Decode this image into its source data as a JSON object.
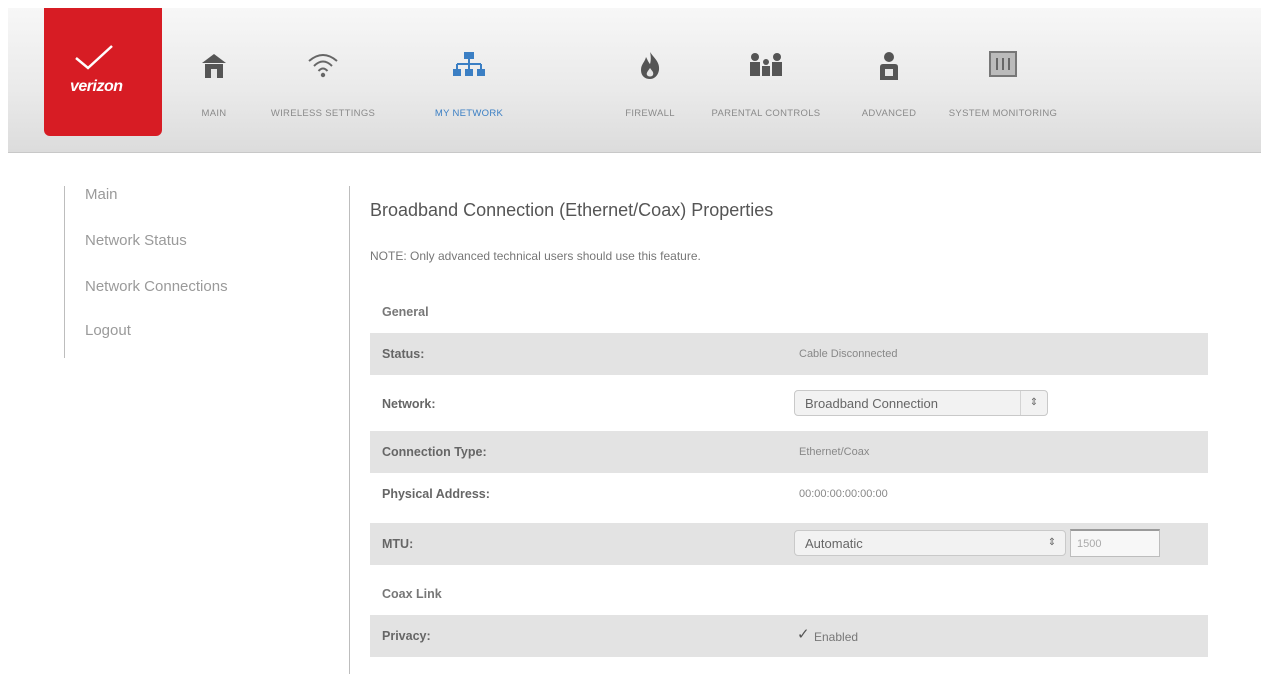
{
  "header": {
    "logo_text": "verizon",
    "nav": [
      {
        "label": "MAIN",
        "icon": "home-icon",
        "active": false
      },
      {
        "label": "WIRELESS SETTINGS",
        "icon": "wifi-icon",
        "active": false
      },
      {
        "label": "MY NETWORK",
        "icon": "network-icon",
        "active": true
      },
      {
        "label": "FIREWALL",
        "icon": "fire-icon",
        "active": false
      },
      {
        "label": "PARENTAL CONTROLS",
        "icon": "family-icon",
        "active": false
      },
      {
        "label": "ADVANCED",
        "icon": "admin-icon",
        "active": false
      },
      {
        "label": "SYSTEM MONITORING",
        "icon": "monitor-icon",
        "active": false
      }
    ]
  },
  "sidebar": {
    "items": [
      {
        "label": "Main"
      },
      {
        "label": "Network Status"
      },
      {
        "label": "Network Connections"
      },
      {
        "label": "Logout"
      }
    ]
  },
  "main": {
    "title": "Broadband Connection (Ethernet/Coax) Properties",
    "note": "NOTE: Only advanced technical users should use this feature.",
    "general_heading": "General",
    "status_label": "Status:",
    "status_value": "Cable Disconnected",
    "network_label": "Network:",
    "network_selected": "Broadband Connection",
    "connection_type_label": "Connection Type:",
    "connection_type_value": "Ethernet/Coax",
    "physical_address_label": "Physical Address:",
    "physical_address_value": "00:00:00:00:00:00",
    "mtu_label": "MTU:",
    "mtu_selected": "Automatic",
    "mtu_value": "1500",
    "coax_heading": "Coax Link",
    "privacy_label": "Privacy:",
    "privacy_checkbox_label": "Enabled"
  },
  "colors": {
    "brand_red": "#d71c24",
    "active_blue": "#3b7fc4",
    "row_shade": "#e3e3e3"
  }
}
